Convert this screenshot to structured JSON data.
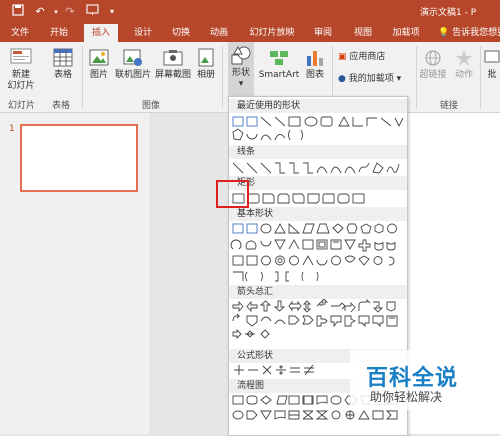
{
  "title_bar": {
    "app_title": "演示文稿1 - P",
    "icons": [
      "save-icon",
      "undo-icon",
      "redo-icon",
      "start-from-beginning-icon",
      "qat-dropdown-icon"
    ]
  },
  "tabs": [
    {
      "label": "文件",
      "active": false
    },
    {
      "label": "开始",
      "active": false
    },
    {
      "label": "插入",
      "active": true
    },
    {
      "label": "设计",
      "active": false
    },
    {
      "label": "切换",
      "active": false
    },
    {
      "label": "动画",
      "active": false
    },
    {
      "label": "幻灯片放映",
      "active": false
    },
    {
      "label": "审阅",
      "active": false
    },
    {
      "label": "视图",
      "active": false
    },
    {
      "label": "加载项",
      "active": false
    }
  ],
  "tell_me": "告诉我您想要",
  "ribbon": {
    "new_slide_line1": "新建",
    "new_slide_line2": "幻灯片",
    "table": "表格",
    "picture": "图片",
    "online_picture": "联机图片",
    "screenshot": "屏幕截图",
    "album": "相册",
    "shapes": "形状",
    "smartart": "SmartArt",
    "chart": "图表",
    "store": "应用商店",
    "my_addins": "我的加载项",
    "hyperlink": "超链接",
    "action": "动作",
    "comment": "批",
    "groups": {
      "slides": "幻灯片",
      "tables": "表格",
      "images": "图像",
      "links": "链接"
    }
  },
  "slides_pane": {
    "slide_number": "1"
  },
  "shapes_gallery": {
    "categories": [
      {
        "label": "最近使用的形状"
      },
      {
        "label": "线条"
      },
      {
        "label": "矩形"
      },
      {
        "label": "基本形状"
      },
      {
        "label": "箭头总汇"
      },
      {
        "label": "公式形状"
      },
      {
        "label": "流程图"
      }
    ]
  },
  "watermark": {
    "title": "百科全说",
    "subtitle": "助你轻松解决"
  },
  "colors": {
    "accent": "#b7472a",
    "highlight": "#e02020",
    "watermark": "#1a7fc4"
  }
}
